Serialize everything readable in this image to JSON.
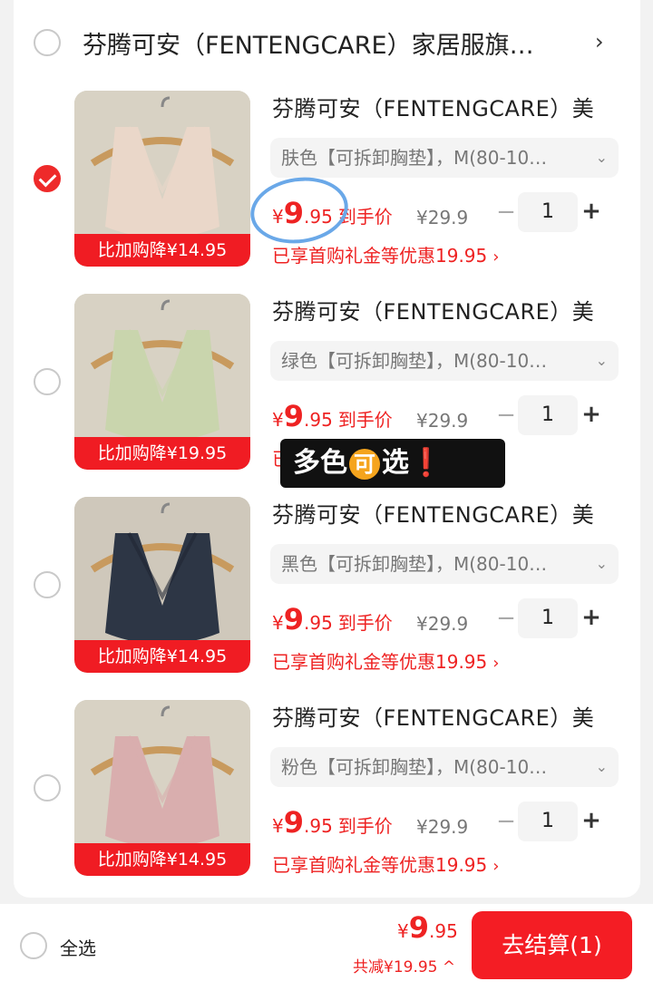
{
  "store": {
    "name": "芬腾可安（FENTENGCARE）家居服旗…",
    "arrow": "›"
  },
  "items": [
    {
      "title": "芬腾可安（FENTENGCARE）美",
      "sku": "肤色【可拆卸胸垫】，M(80-10…",
      "price_yen": "¥",
      "price_int": "9",
      "price_dec": ".95",
      "price_tag": "到手价",
      "original_price": "¥29.9",
      "quantity": "1",
      "promo": "已享首购礼金等优惠19.95",
      "badge": "比加购降¥14.95",
      "checked": true,
      "color": "#ead7c9"
    },
    {
      "title": "芬腾可安（FENTENGCARE）美",
      "sku": "绿色【可拆卸胸垫】，M(80-10…",
      "price_yen": "¥",
      "price_int": "9",
      "price_dec": ".95",
      "price_tag": "到手价",
      "original_price": "¥29.9",
      "quantity": "1",
      "promo": "已享首购礼金等优惠19.95",
      "badge": "比加购降¥19.95",
      "checked": false,
      "color": "#c9d5ad"
    },
    {
      "title": "芬腾可安（FENTENGCARE）美",
      "sku": "黑色【可拆卸胸垫】，M(80-10…",
      "price_yen": "¥",
      "price_int": "9",
      "price_dec": ".95",
      "price_tag": "到手价",
      "original_price": "¥29.9",
      "quantity": "1",
      "promo": "已享首购礼金等优惠19.95",
      "badge": "比加购降¥14.95",
      "checked": false,
      "color": "#2d3645"
    },
    {
      "title": "芬腾可安（FENTENGCARE）美",
      "sku": "粉色【可拆卸胸垫】，M(80-10…",
      "price_yen": "¥",
      "price_int": "9",
      "price_dec": ".95",
      "price_tag": "到手价",
      "original_price": "¥29.9",
      "quantity": "1",
      "promo": "已享首购礼金等优惠19.95",
      "badge": "比加购降¥14.95",
      "checked": false,
      "color": "#d9aeae"
    }
  ],
  "overlay": {
    "text_a": "多色",
    "text_b": "可",
    "text_c": "选",
    "text_d": "❗"
  },
  "controls": {
    "minus": "−",
    "plus": "+",
    "chevron": "⌄",
    "promo_arrow": "›"
  },
  "bottom": {
    "select_all": "全选",
    "total_yen": "¥",
    "total_int": "9",
    "total_dec": ".95",
    "saved": "共减¥19.95 ^",
    "checkout": "去结算(1)"
  },
  "colors": {
    "accent": "#f41d24",
    "annotation_circle": "#6aa8e8"
  }
}
